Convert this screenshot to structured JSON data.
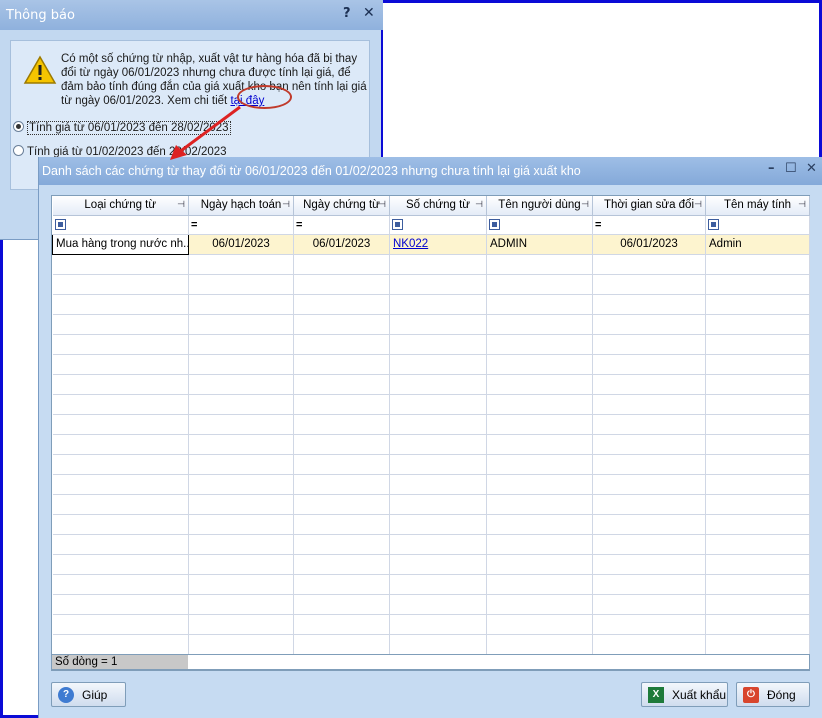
{
  "back_dialog": {
    "title": "Thông báo",
    "help_glyph": "?",
    "close_glyph": "✕",
    "message": "Có một số chứng từ nhập, xuất vật tư hàng hóa đã bị thay đổi từ ngày 06/01/2023 nhưng chưa được tính lại giá, để đảm bảo tính đúng đắn của giá xuất kho bạn nên tính lại giá từ ngày 06/01/2023. Xem chi tiết",
    "link": "tại đây",
    "radio1": "Tính giá từ 06/01/2023 đến 28/02/2023",
    "radio2": "Tính giá từ 01/02/2023 đến 28/02/2023"
  },
  "main_window": {
    "title": "Danh sách các chứng từ thay đổi từ 06/01/2023 đến 01/02/2023 nhưng chưa tính lại giá xuất kho",
    "minimize_glyph": "–",
    "maximize_glyph": "☐",
    "close_glyph": "✕",
    "columns": [
      "Loại chứng từ",
      "Ngày hạch toán",
      "Ngày chứng từ",
      "Số chứng từ",
      "Tên người dùng",
      "Thời gian sửa đổi",
      "Tên máy tính"
    ],
    "row": {
      "type": "Mua hàng trong nước nh...",
      "posting_date": "06/01/2023",
      "doc_date": "06/01/2023",
      "doc_no": "NK022",
      "user": "ADMIN",
      "modified": "06/01/2023",
      "computer": "Admin"
    },
    "status": "Số dòng = 1",
    "help_button": "Giúp",
    "export_button": "Xuất khẩu",
    "close_button": "Đóng"
  },
  "icons": [
    "warning-icon",
    "pin-icon",
    "filter-icon",
    "help-icon",
    "excel-icon",
    "power-icon"
  ],
  "colors": {
    "accent_blue": "#0b0bd6",
    "annotation_red": "#c03a2b",
    "row_highlight": "#fdf4cf"
  }
}
